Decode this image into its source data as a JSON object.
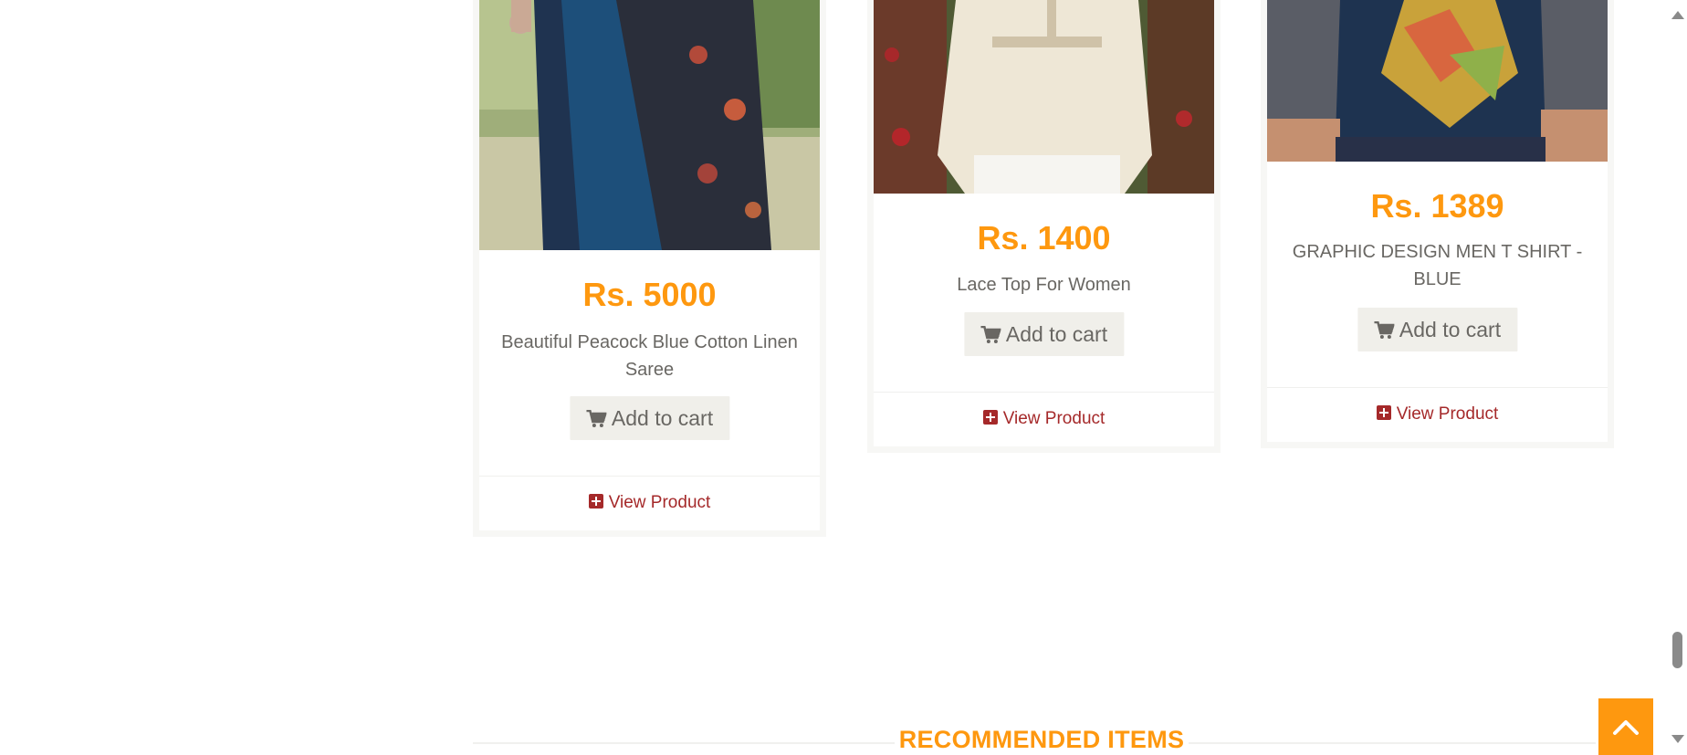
{
  "products": [
    {
      "price": "Rs. 5000",
      "name": "Beautiful Peacock Blue Cotton Linen Saree",
      "add_to_cart": "Add to cart",
      "view_product": "View Product",
      "image_description": "saree"
    },
    {
      "price": "Rs. 1400",
      "name": "Lace Top For Women",
      "add_to_cart": "Add to cart",
      "view_product": "View Product",
      "image_description": "lace top"
    },
    {
      "price": "Rs. 1389",
      "name": "GRAPHIC DESIGN MEN T SHIRT - BLUE",
      "add_to_cart": "Add to cart",
      "view_product": "View Product",
      "image_description": "t shirt"
    }
  ],
  "recommended": {
    "title": "RECOMMENDED ITEMS"
  },
  "colors": {
    "accent": "#fe980f",
    "link": "#a5292a",
    "text": "#696763",
    "button_bg": "#f0efea"
  },
  "icons": {
    "cart": "shopping-cart-icon",
    "view": "plus-square-icon",
    "scroll_up": "chevron-up-icon"
  }
}
